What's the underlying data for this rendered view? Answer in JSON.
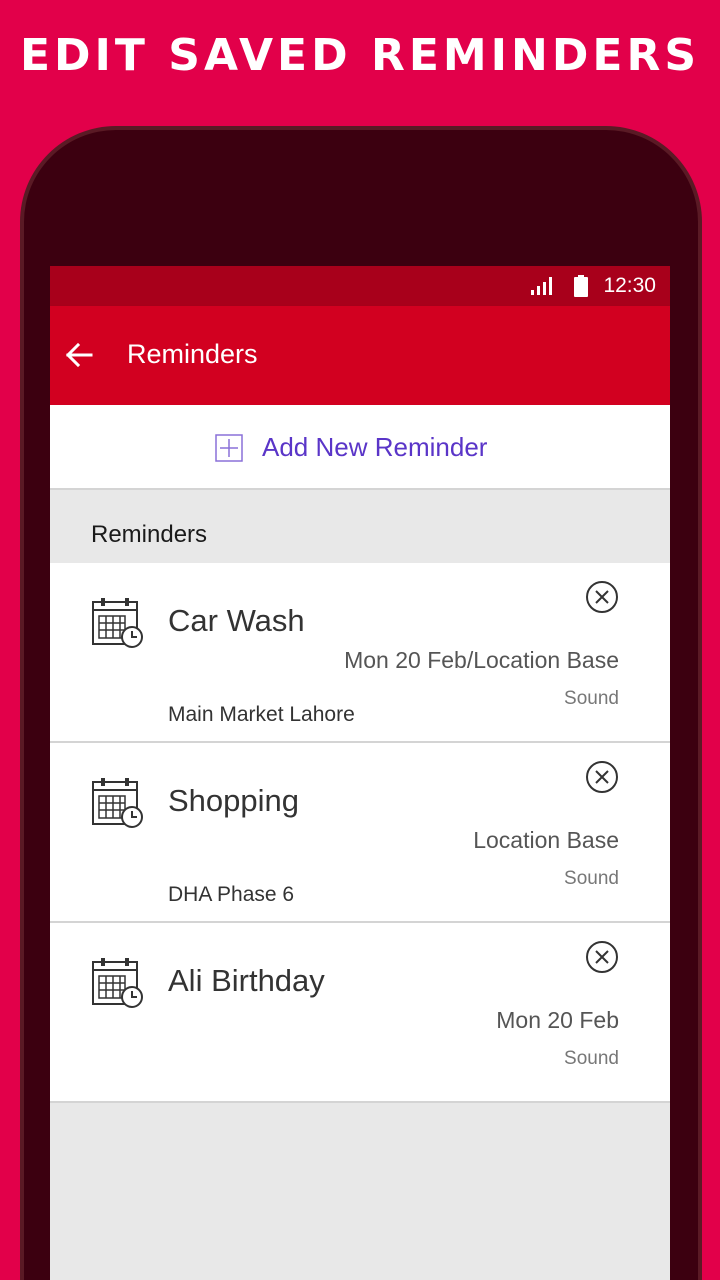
{
  "banner": {
    "title": "EDIT SAVED REMINDERS"
  },
  "status_bar": {
    "time": "12:30"
  },
  "app_bar": {
    "title": "Reminders",
    "back_icon": "arrow-left-icon"
  },
  "add_row": {
    "label": "Add New Reminder",
    "icon": "plus-square-icon"
  },
  "section": {
    "title": "Reminders"
  },
  "reminders": [
    {
      "title": "Car Wash",
      "when": "Mon 20 Feb/Location Base",
      "sound": "Sound",
      "location": "Main Market Lahore"
    },
    {
      "title": "Shopping",
      "when": "Location Base",
      "sound": "Sound",
      "location": "DHA Phase 6"
    },
    {
      "title": "Ali Birthday",
      "when": "Mon 20 Feb",
      "sound": "Sound",
      "location": ""
    }
  ],
  "colors": {
    "background": "#e2004a",
    "status_bar": "#a8001b",
    "app_bar": "#d20020",
    "accent": "#5a35c8"
  }
}
